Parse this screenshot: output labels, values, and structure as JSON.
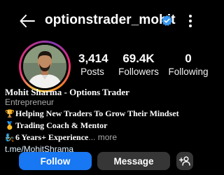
{
  "header": {
    "username": "optionstrader_mohit",
    "back_icon": "arrow-left-icon",
    "verified_icon": "verified-badge-icon",
    "menu_icon": "more-vertical-icon",
    "verified_color": "#3897f0"
  },
  "profile": {
    "avatar_icon": "profile-photo",
    "ring_colors": [
      "#f9ce34",
      "#ee2a7b",
      "#833ab4"
    ]
  },
  "stats": {
    "posts": {
      "value": "3,414",
      "label": "Posts"
    },
    "followers": {
      "value": "69.4K",
      "label": "Followers"
    },
    "following": {
      "value": "0",
      "label": "Following"
    }
  },
  "bio": {
    "name": "Mohit Sharma - Options Trader",
    "category": "Entrepreneur",
    "lines": [
      {
        "emoji": "🏆",
        "text": "Helping New Traders To Grow Their Mindset"
      },
      {
        "emoji": "🥇",
        "text": "Trading Coach & Mentor"
      },
      {
        "emoji": "🧞",
        "text": "6 Years+ Experience",
        "suffix": "... more"
      }
    ],
    "link": "t.me/MohitShrama"
  },
  "actions": {
    "follow": "Follow",
    "message": "Message",
    "add_user_icon": "add-user-icon",
    "follow_color": "#1877f2"
  }
}
